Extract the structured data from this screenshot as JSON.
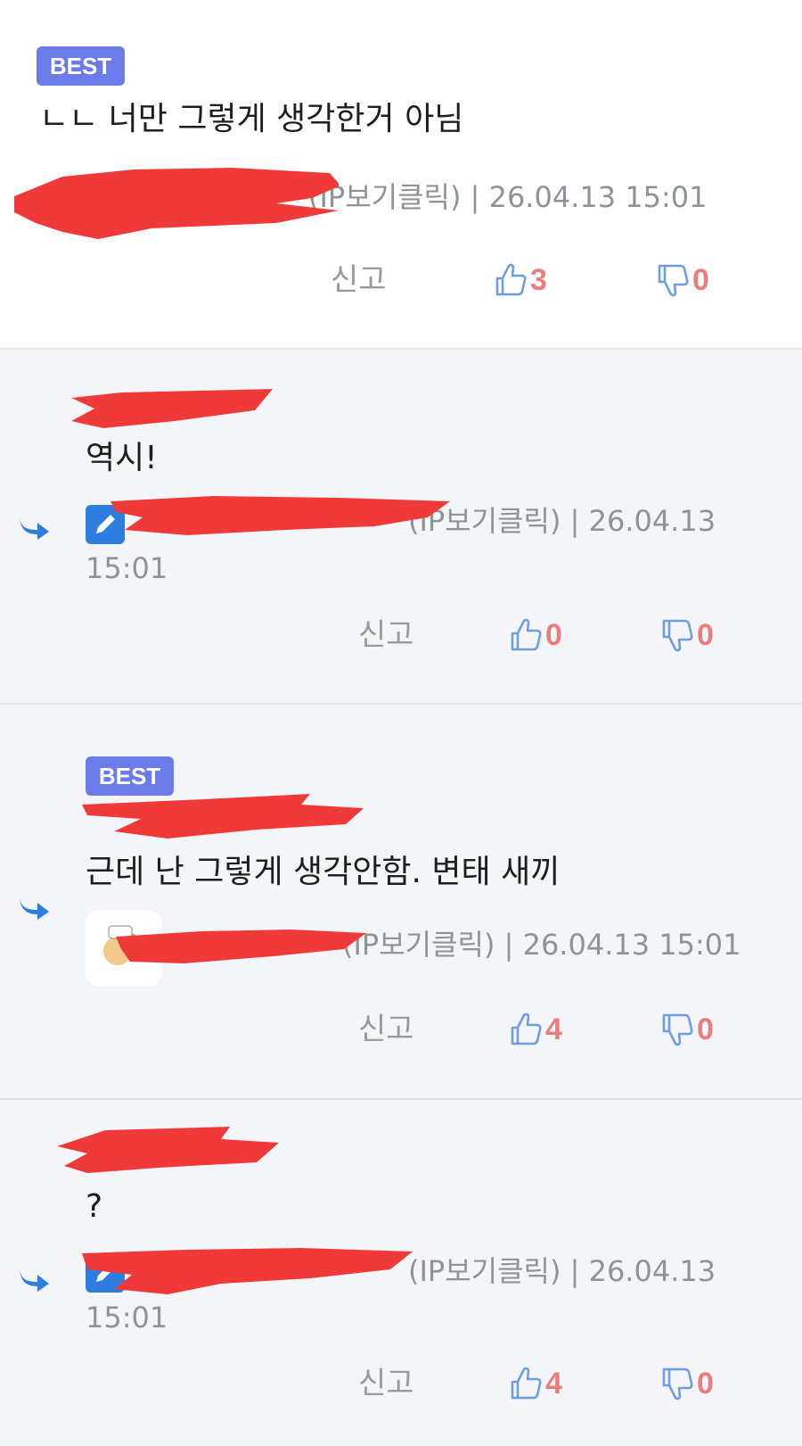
{
  "badge_best": "BEST",
  "comments": [
    {
      "text": "ㄴㄴ 너만 그렇게 생각한거 아님",
      "meta": "(IP보기클릭) | 26.04.13 15:01",
      "report": "신고",
      "up": "3",
      "down": "0"
    },
    {
      "text": "역시!",
      "meta": "(IP보기클릭) | 26.04.13",
      "time": "15:01",
      "report": "신고",
      "up": "0",
      "down": "0"
    },
    {
      "text": "근데 난 그렇게 생각안함. 변태 새끼",
      "meta": "(IP보기클릭) | 26.04.13 15:01",
      "report": "신고",
      "up": "4",
      "down": "0"
    },
    {
      "text": "?",
      "meta": "(IP보기클릭) | 26.04.13",
      "time": "15:01",
      "report": "신고",
      "up": "4",
      "down": "0"
    }
  ],
  "colors": {
    "best_badge": "#6b7be8",
    "count": "#ec7d7d",
    "thumb_icon": "#6f9ee0",
    "reply_arrow": "#2d7ee0",
    "redaction": "#f03a3a"
  },
  "icons": {
    "reply": "reply-arrow-icon",
    "up": "thumbs-up-icon",
    "down": "thumbs-down-icon",
    "edit": "pencil-icon"
  }
}
